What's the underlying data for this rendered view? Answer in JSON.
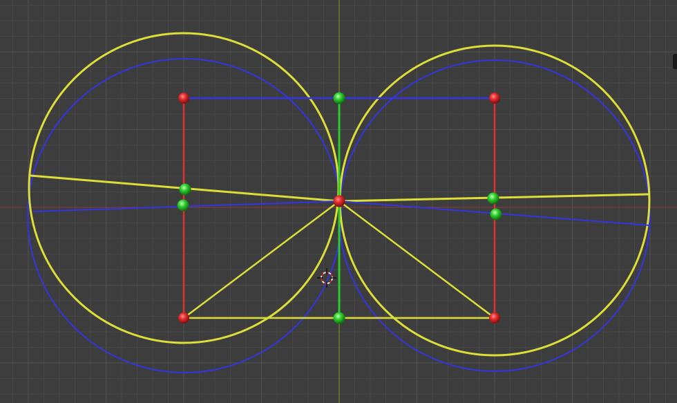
{
  "viewport": {
    "background": "#3d3d3d",
    "grid_minor_color": "#474747",
    "grid_major_color": "#525252",
    "x_axis_color": "#8a3a3a",
    "y_axis_color": "#7a9a2a"
  },
  "colors": {
    "yellow": "#dede3a",
    "blue": "#3434e0",
    "red": "#e03030",
    "green": "#2ccc2c"
  },
  "icons": {
    "cursor": "3d-cursor-icon"
  }
}
